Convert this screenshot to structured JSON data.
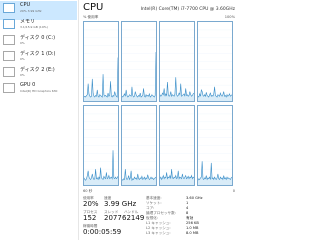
{
  "sidebar": {
    "items": [
      {
        "name": "CPU",
        "sub": "20%  3.99 GHz"
      },
      {
        "name": "メモリ",
        "sub": "3.1/15.9 GB (19%)"
      },
      {
        "name": "ディスク 0 (C:)",
        "sub": "0%"
      },
      {
        "name": "ディスク 1 (D:)",
        "sub": "0%"
      },
      {
        "name": "ディスク 2 (E:)",
        "sub": "0%"
      },
      {
        "name": "GPU 0",
        "sub": "Intel(R) HD Graphics 630"
      }
    ]
  },
  "header": {
    "title": "CPU",
    "model": "Intel(R) Core(TM) i7-7700 CPU @ 3.60GHz"
  },
  "graph": {
    "util_label": "% 使用率",
    "max_label": "100%",
    "time_label": "60 秒",
    "min_label": "0"
  },
  "stats": {
    "util_label": "使用率",
    "util_value": "20%",
    "speed_label": "速度",
    "speed_value": "3.99 GHz",
    "proc_label": "プロセス",
    "proc_value": "152",
    "threads_label": "スレッド",
    "threads_value": "2077",
    "handles_label": "ハンドル",
    "handles_value": "62149",
    "uptime_label": "稼働時間",
    "uptime_value": "0:00:05:59"
  },
  "specs": {
    "base_speed_label": "基本速度:",
    "base_speed_value": "3.60 GHz",
    "sockets_label": "ソケット:",
    "sockets_value": "1",
    "cores_label": "コア:",
    "cores_value": "4",
    "lp_label": "論理プロセッサ数:",
    "lp_value": "8",
    "virt_label": "仮想化:",
    "virt_value": "有効",
    "l1_label": "L1 キャッシュ:",
    "l1_value": "256 KB",
    "l2_label": "L2 キャッシュ:",
    "l2_value": "1.0 MB",
    "l3_label": "L3 キャッシュ:",
    "l3_value": "8.0 MB"
  },
  "colors": {
    "accent": "#1a7ab8",
    "line": "#3a8ec8",
    "fill": "#d9ecf8",
    "selected": "#cce8ff"
  },
  "cpu_history": [
    [
      5,
      6,
      5,
      7,
      8,
      22,
      9,
      6,
      5,
      6,
      28,
      10,
      6,
      5,
      7,
      6,
      14,
      6,
      5,
      8,
      7,
      6,
      5,
      34,
      8,
      6,
      7,
      6,
      5,
      10,
      6,
      7,
      25,
      6,
      5,
      7,
      6,
      12,
      8,
      6,
      5,
      55
    ],
    [
      6,
      5,
      7,
      9,
      6,
      14,
      7,
      5,
      6,
      8,
      7,
      6,
      18,
      7,
      5,
      6,
      12,
      8,
      6,
      5,
      7,
      6,
      10,
      5,
      6,
      7,
      16,
      6,
      5,
      8,
      6,
      7,
      6,
      9,
      5,
      6,
      8,
      7,
      6,
      5,
      7,
      62
    ],
    [
      8,
      6,
      7,
      10,
      8,
      16,
      6,
      9,
      7,
      24,
      8,
      6,
      7,
      12,
      6,
      8,
      7,
      6,
      9,
      30,
      8,
      6,
      7,
      10,
      8,
      22,
      6,
      7,
      8,
      9,
      6,
      16,
      7,
      8,
      6,
      7,
      12,
      8,
      6,
      7,
      9,
      10
    ],
    [
      6,
      5,
      9,
      6,
      14,
      12,
      7,
      6,
      8,
      6,
      11,
      7,
      6,
      5,
      8,
      10,
      6,
      7,
      6,
      9,
      18,
      7,
      6,
      5,
      8,
      7,
      6,
      10,
      7,
      6,
      8,
      12,
      6,
      7,
      5,
      8,
      6,
      7,
      9,
      6,
      7,
      8
    ],
    [
      9,
      7,
      6,
      8,
      12,
      18,
      10,
      8,
      7,
      9,
      14,
      9,
      7,
      8,
      20,
      8,
      9,
      7,
      10,
      8,
      22,
      9,
      8,
      7,
      11,
      9,
      8,
      16,
      8,
      9,
      12,
      8,
      9,
      10,
      8,
      44,
      9,
      8,
      10,
      8,
      9,
      11
    ],
    [
      7,
      6,
      8,
      7,
      20,
      9,
      7,
      8,
      12,
      7,
      9,
      18,
      6,
      8,
      7,
      10,
      8,
      9,
      7,
      14,
      8,
      7,
      9,
      8,
      11,
      7,
      8,
      10,
      7,
      9,
      8,
      13,
      9,
      7,
      8,
      10,
      8,
      9,
      7,
      8,
      9,
      10
    ],
    [
      8,
      10,
      7,
      9,
      12,
      8,
      10,
      9,
      16,
      8,
      10,
      9,
      12,
      8,
      20,
      9,
      8,
      10,
      9,
      12,
      8,
      9,
      18,
      8,
      10,
      9,
      8,
      14,
      9,
      8,
      10,
      12,
      8,
      9,
      11,
      8,
      10,
      9,
      12,
      8,
      10,
      9
    ],
    [
      6,
      8,
      7,
      9,
      10,
      30,
      8,
      7,
      9,
      8,
      12,
      7,
      9,
      8,
      10,
      7,
      28,
      8,
      9,
      7,
      10,
      8,
      7,
      9,
      14,
      8,
      7,
      10,
      8,
      9,
      7,
      12,
      8,
      9,
      7,
      10,
      8,
      9,
      8,
      7,
      9,
      10
    ]
  ]
}
